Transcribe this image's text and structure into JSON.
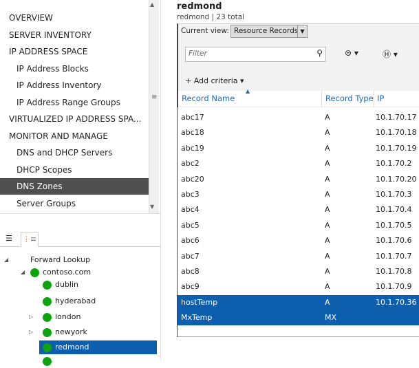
{
  "nav": {
    "items": [
      {
        "label": "OVERVIEW",
        "level": 0
      },
      {
        "label": "SERVER INVENTORY",
        "level": 0
      },
      {
        "label": "IP ADDRESS SPACE",
        "level": 0
      },
      {
        "label": "IP Address Blocks",
        "level": 1
      },
      {
        "label": "IP Address Inventory",
        "level": 1
      },
      {
        "label": "IP Address Range Groups",
        "level": 1
      },
      {
        "label": "VIRTUALIZED IP ADDRESS SPA...",
        "level": 0
      },
      {
        "label": "MONITOR AND MANAGE",
        "level": 0
      },
      {
        "label": "DNS and DHCP Servers",
        "level": 1
      },
      {
        "label": "DHCP Scopes",
        "level": 1
      },
      {
        "label": "DNS Zones",
        "level": 1,
        "selected": true
      },
      {
        "label": "Server Groups",
        "level": 1
      }
    ]
  },
  "tree": {
    "root": "Forward Lookup",
    "zone": "contoso.com",
    "children": [
      "dublin",
      "hyderabad",
      "london",
      "newyork",
      "redmond"
    ],
    "selected": "redmond"
  },
  "main": {
    "title": "redmond",
    "subtitle": "redmond | 23 total",
    "current_view_label": "Current view:",
    "current_view_value": "Resource Records",
    "filter_placeholder": "Filter",
    "add_criteria": "+ Add criteria",
    "columns": [
      "Record Name",
      "Record Type",
      "IP Address"
    ],
    "rows": [
      [
        "abc17",
        "A",
        "10.1.70.17"
      ],
      [
        "abc18",
        "A",
        "10.1.70.18"
      ],
      [
        "abc19",
        "A",
        "10.1.70.19"
      ],
      [
        "abc2",
        "A",
        "10.1.70.2"
      ],
      [
        "abc20",
        "A",
        "10.1.70.20"
      ],
      [
        "abc3",
        "A",
        "10.1.70.3"
      ],
      [
        "abc4",
        "A",
        "10.1.70.4"
      ],
      [
        "abc5",
        "A",
        "10.1.70.5"
      ],
      [
        "abc6",
        "A",
        "10.1.70.6"
      ],
      [
        "abc7",
        "A",
        "10.1.70.7"
      ],
      [
        "abc8",
        "A",
        "10.1.70.8"
      ],
      [
        "abc9",
        "A",
        "10.1.70.9"
      ],
      [
        "hostTemp",
        "A",
        "10.1.70.36"
      ],
      [
        "MxTemp",
        "MX",
        ""
      ]
    ],
    "selected_rows": [
      12,
      13
    ]
  },
  "colors": {
    "selection": "#0d5fae",
    "nav_selected": "#4f4f4f",
    "header_text": "#1e6bb8",
    "status_green": "#0fa30f"
  }
}
